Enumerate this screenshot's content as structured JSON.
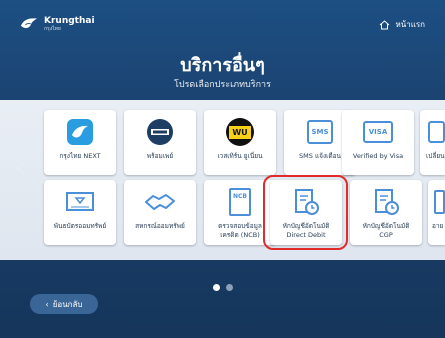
{
  "header": {
    "brand": "Krungthai",
    "brand_sub": "กรุงไทย",
    "home_label": "หน้าแรก"
  },
  "page": {
    "title": "บริการอื่นๆ",
    "subtitle": "โปรดเลือกประเภทบริการ"
  },
  "tiles": [
    {
      "label": "กรุงไทย NEXT",
      "icon": "krungthai-next-icon"
    },
    {
      "label": "พร้อมเพย์",
      "icon": "promptpay-icon"
    },
    {
      "label": "เวสเทิร์น ยูเนี่ยน",
      "icon": "western-union-icon",
      "icon_text": "WU"
    },
    {
      "label": "SMS แจ้งเตือน",
      "icon": "sms-icon",
      "icon_text": "SMS"
    },
    {
      "label": "Verified by Visa",
      "icon": "visa-icon",
      "icon_text": "VISA"
    },
    {
      "label": "พันธบัตรออมทรัพย์",
      "icon": "bond-icon"
    },
    {
      "label": "สหกรณ์ออมทรัพย์",
      "icon": "handshake-icon"
    },
    {
      "label": "ตรวจสอบข้อมูล",
      "label2": "เครดิต (NCB)",
      "icon": "ncb-icon",
      "icon_text": "NCB"
    },
    {
      "label": "หักบัญชีอัตโนมัติ",
      "label2": "Direct Debit",
      "icon": "direct-debit-icon"
    },
    {
      "label": "หักบัญชีอัตโนมัติ",
      "label2": "CGP",
      "icon": "cgp-icon"
    }
  ],
  "partial_tiles": [
    {
      "label": "เปลี่ยน",
      "icon": "partial-tile-icon"
    },
    {
      "label": "อาย",
      "icon": "partial-tile-icon"
    }
  ],
  "footer": {
    "back_label": "ย้อนกลับ"
  },
  "colors": {
    "highlight": "#e12a2a",
    "primary": "#1d4f83"
  }
}
